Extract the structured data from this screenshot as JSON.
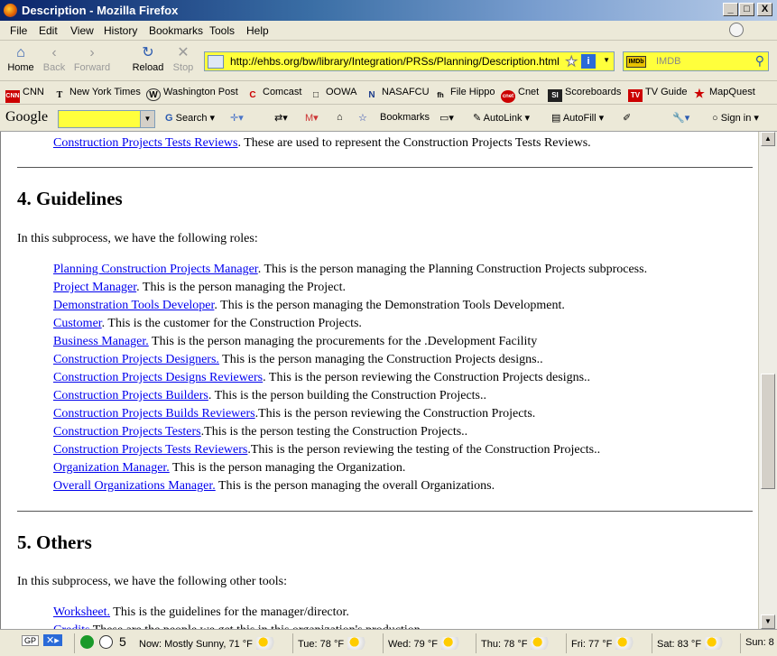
{
  "window": {
    "title": "Description - Mozilla Firefox",
    "min": "_",
    "max": "□",
    "close": "X"
  },
  "menu": [
    "File",
    "Edit",
    "View",
    "History",
    "Bookmarks",
    "Tools",
    "Help"
  ],
  "nav": {
    "home": "Home",
    "back": "Back",
    "forward": "Forward",
    "reload": "Reload",
    "stop": "Stop"
  },
  "url": "http://ehbs.org/bw/library/Integration/PRSs/Planning/Description.html",
  "search": {
    "engine": "IMDb",
    "placeholder": "IMDB"
  },
  "bookmarks": [
    {
      "label": "CNN",
      "icon": "CNN"
    },
    {
      "label": "New York Times",
      "icon": "T"
    },
    {
      "label": "Washington Post",
      "icon": "W"
    },
    {
      "label": "Comcast",
      "icon": "C"
    },
    {
      "label": "OOWA",
      "icon": "□"
    },
    {
      "label": "NASAFCU",
      "icon": "N"
    },
    {
      "label": "File Hippo",
      "icon": "fh"
    },
    {
      "label": "Cnet",
      "icon": "cnet"
    },
    {
      "label": "Scoreboards",
      "icon": "SI"
    },
    {
      "label": "TV Guide",
      "icon": "TV"
    },
    {
      "label": "MapQuest",
      "icon": "★"
    }
  ],
  "google_toolbar": {
    "logo": "Google",
    "search": "Search",
    "bookmarks": "Bookmarks",
    "autolink": "AutoLink",
    "autofill": "AutoFill",
    "signin": "Sign in"
  },
  "content": {
    "top_line": {
      "link": "Construction Projects Tests Reviews",
      "text": ". These are used to represent the Construction Projects Tests Reviews."
    },
    "section4": {
      "heading": "4. Guidelines",
      "intro": "In this subprocess, we have the following roles:",
      "roles": [
        {
          "link": "Planning Construction Projects Manager",
          "text": ". This is the person managing the Planning Construction Projects subprocess."
        },
        {
          "link": "Project Manager",
          "text": ". This is the person managing the Project."
        },
        {
          "link": "Demonstration Tools Developer",
          "text": ". This is the person managing the Demonstration Tools Development."
        },
        {
          "link": "Customer",
          "text": ". This is the customer for the Construction Projects."
        },
        {
          "link": "Business Manager.",
          "text": " This is the person managing the procurements for the .Development Facility"
        },
        {
          "link": "Construction Projects Designers.",
          "text": " This is the person managing the Construction Projects designs.."
        },
        {
          "link": "Construction Projects Designs Reviewers",
          "text": ". This is the person reviewing the Construction Projects designs.."
        },
        {
          "link": "Construction Projects Builders",
          "text": ". This is the person building the Construction Projects.."
        },
        {
          "link": "Construction Projects Builds Reviewers",
          "text": ".This is the person reviewing the Construction Projects."
        },
        {
          "link": "Construction Projects Testers",
          "text": ".This is the person testing the Construction Projects.."
        },
        {
          "link": "Construction Projects Tests Reviewers",
          "text": ".This is the person reviewing the testing of the Construction Projects.."
        },
        {
          "link": "Organization Manager.",
          "text": " This is the person managing the Organization."
        },
        {
          "link": "Overall Organizations Manager.",
          "text": " This is the person managing the overall Organizations."
        }
      ]
    },
    "section5": {
      "heading": "5. Others",
      "intro": "In this subprocess, we have the following other tools:",
      "items": [
        {
          "link": "Worksheet.",
          "text": " This is the guidelines for the manager/director."
        },
        {
          "link": "Credits",
          "text": " These are the people we get this in this organization's production."
        }
      ]
    }
  },
  "status": {
    "count": "5",
    "weather": [
      {
        "label": "Now: Mostly Sunny, 71 °F"
      },
      {
        "label": "Tue: 78 °F"
      },
      {
        "label": "Wed: 79 °F"
      },
      {
        "label": "Thu: 78 °F"
      },
      {
        "label": "Fri: 77 °F"
      },
      {
        "label": "Sat: 83 °F"
      },
      {
        "label": "Sun: 8"
      }
    ]
  },
  "colors": {
    "link": "#0000ee",
    "url_bg": "#ffff3c",
    "chrome": "#ece9d8"
  }
}
